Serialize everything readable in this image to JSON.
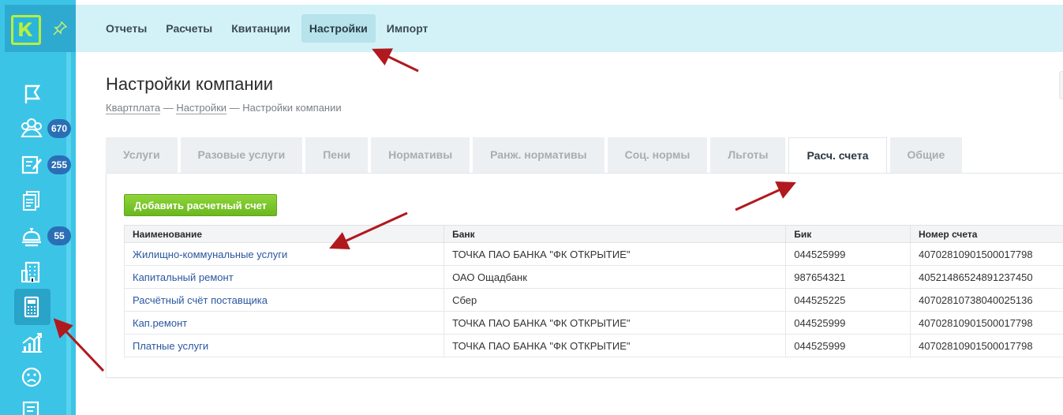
{
  "app": {
    "logo_letter": "К",
    "accent": "#3cc4e6",
    "logo_color": "#b6ef3f"
  },
  "sidebar": {
    "items": [
      {
        "icon": "flag-icon"
      },
      {
        "icon": "residents-icon",
        "badge": "670"
      },
      {
        "icon": "edit-doc-icon",
        "badge": "255"
      },
      {
        "icon": "documents-icon"
      },
      {
        "icon": "bell-service-icon",
        "badge": "55"
      },
      {
        "icon": "building-icon"
      },
      {
        "icon": "calculator-icon",
        "active": true
      },
      {
        "icon": "growth-chart-icon"
      },
      {
        "icon": "sad-face-icon"
      },
      {
        "icon": "report-icon"
      }
    ]
  },
  "topnav": {
    "items": [
      {
        "label": "Отчеты"
      },
      {
        "label": "Расчеты"
      },
      {
        "label": "Квитанции"
      },
      {
        "label": "Настройки",
        "active": true
      },
      {
        "label": "Импорт"
      }
    ]
  },
  "page": {
    "title": "Настройки компании",
    "breadcrumb": {
      "link1": "Квартплата",
      "sep1": " — ",
      "link2": "Настройки",
      "sep2": " — ",
      "current": "Настройки компании"
    }
  },
  "tabs": [
    {
      "label": "Услуги"
    },
    {
      "label": "Разовые услуги"
    },
    {
      "label": "Пени"
    },
    {
      "label": "Нормативы"
    },
    {
      "label": "Ранж. нормативы"
    },
    {
      "label": "Соц. нормы"
    },
    {
      "label": "Льготы"
    },
    {
      "label": "Расч. счета",
      "active": true
    },
    {
      "label": "Общие"
    }
  ],
  "accounts": {
    "add_button": "Добавить расчетный счет",
    "columns": [
      "Наименование",
      "Банк",
      "Бик",
      "Номер счета"
    ],
    "rows": [
      [
        "Жилищно-коммунальные услуги",
        "ТОЧКА ПАО БАНКА \"ФК ОТКРЫТИЕ\"",
        "044525999",
        "40702810901500017798"
      ],
      [
        "Капитальный ремонт",
        "ОАО Ощадбанк",
        "987654321",
        "40521486524891237450"
      ],
      [
        "Расчётный счёт поставщика",
        "Сбер",
        "044525225",
        "40702810738040025136"
      ],
      [
        "Кап.ремонт",
        "ТОЧКА ПАО БАНКА \"ФК ОТКРЫТИЕ\"",
        "044525999",
        "40702810901500017798"
      ],
      [
        "Платные услуги",
        "ТОЧКА ПАО БАНКА \"ФК ОТКРЫТИЕ\"",
        "044525999",
        "40702810901500017798"
      ]
    ]
  }
}
